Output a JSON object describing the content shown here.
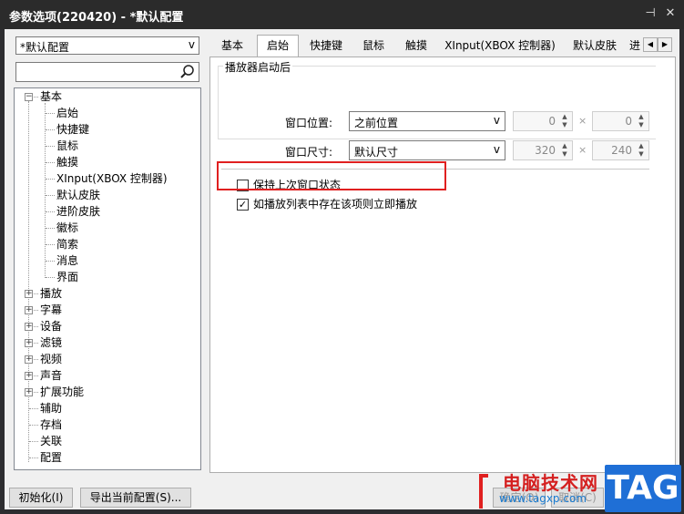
{
  "window": {
    "title": "参数选项(220420) - *默认配置",
    "pin_glyph": "✖",
    "close_glyph": "✕"
  },
  "left": {
    "preset_value": "*默认配置",
    "preset_arrow": "v",
    "search_value": "",
    "tree": [
      {
        "label": "基本",
        "level": 0,
        "expanded": true
      },
      {
        "label": "启始",
        "level": 1
      },
      {
        "label": "快捷键",
        "level": 1
      },
      {
        "label": "鼠标",
        "level": 1
      },
      {
        "label": "触摸",
        "level": 1
      },
      {
        "label": "XInput(XBOX 控制器)",
        "level": 1
      },
      {
        "label": "默认皮肤",
        "level": 1
      },
      {
        "label": "进阶皮肤",
        "level": 1
      },
      {
        "label": "徽标",
        "level": 1
      },
      {
        "label": "简索",
        "level": 1
      },
      {
        "label": "消息",
        "level": 1
      },
      {
        "label": "界面",
        "level": 1
      },
      {
        "label": "播放",
        "level": 0,
        "expanded": false
      },
      {
        "label": "字幕",
        "level": 0,
        "expanded": false
      },
      {
        "label": "设备",
        "level": 0,
        "expanded": false
      },
      {
        "label": "滤镜",
        "level": 0,
        "expanded": false
      },
      {
        "label": "视频",
        "level": 0,
        "expanded": false
      },
      {
        "label": "声音",
        "level": 0,
        "expanded": false
      },
      {
        "label": "扩展功能",
        "level": 0,
        "expanded": false
      },
      {
        "label": "辅助",
        "level": 0
      },
      {
        "label": "存档",
        "level": 0
      },
      {
        "label": "关联",
        "level": 0
      },
      {
        "label": "配置",
        "level": 0
      }
    ]
  },
  "tabs": [
    {
      "label": "基本",
      "active": false
    },
    {
      "label": "启始",
      "active": true
    },
    {
      "label": "快捷键",
      "active": false
    },
    {
      "label": "鼠标",
      "active": false
    },
    {
      "label": "触摸",
      "active": false
    },
    {
      "label": "XInput(XBOX 控制器)",
      "active": false
    },
    {
      "label": "默认皮肤",
      "active": false
    },
    {
      "label": "进",
      "active": false
    }
  ],
  "startup": {
    "group_title": "播放器启动后",
    "position_label": "窗口位置:",
    "position_value": "之前位置",
    "pos_x": "0",
    "pos_y": "0",
    "size_label": "窗口尺寸:",
    "size_value": "默认尺寸",
    "width": "320",
    "height": "240",
    "times": "×",
    "keep_state_label": "保持上次窗口状态",
    "keep_state_checked": false,
    "play_if_in_list_label": "如播放列表中存在该项则立即播放",
    "play_if_in_list_checked": true
  },
  "bottom": {
    "init_button": "初始化(I)",
    "export_button": "导出当前配置(S)...",
    "ok_button": "确定(O)",
    "cancel_button": "取消(C)"
  },
  "watermark": {
    "site_name": "电脑技术网",
    "url": "www.tagxp.com",
    "tag": "TAG"
  },
  "colors": {
    "titlebar": "#2b2b2b",
    "highlight_border": "#e02020",
    "tag_blue": "#1f6fd6"
  }
}
